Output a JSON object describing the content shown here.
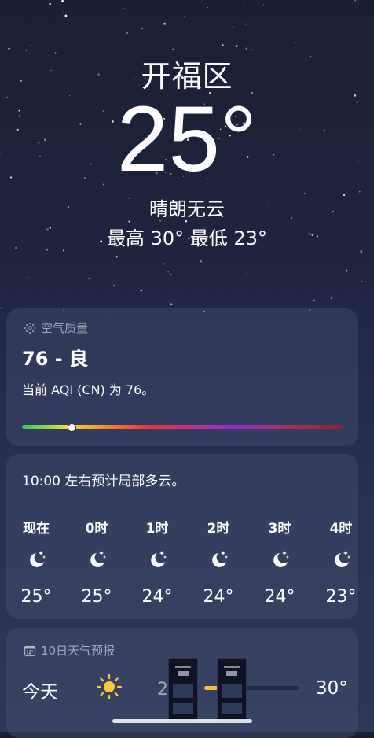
{
  "location": {
    "city": "开福区",
    "temperature": "25°",
    "condition": "晴朗无云",
    "high_low": "最高 30°  最低 23°"
  },
  "aqi": {
    "header": "空气质量",
    "value_label": "76 - 良",
    "description": "当前 AQI (CN) 为 76。",
    "indicator_fraction": 0.155,
    "icon": "aqi-grid-icon"
  },
  "hourly": {
    "summary": "10:00 左右预计局部多云。",
    "items": [
      {
        "label": "现在",
        "icon": "moon-stars-icon",
        "temp": "25°"
      },
      {
        "label": "0时",
        "icon": "moon-stars-icon",
        "temp": "25°"
      },
      {
        "label": "1时",
        "icon": "moon-stars-icon",
        "temp": "24°"
      },
      {
        "label": "2时",
        "icon": "moon-stars-icon",
        "temp": "24°"
      },
      {
        "label": "3时",
        "icon": "moon-stars-icon",
        "temp": "24°"
      },
      {
        "label": "4时",
        "icon": "moon-stars-icon",
        "temp": "23°"
      }
    ]
  },
  "ten_day": {
    "header": "10日天气预报",
    "icon": "calendar-icon",
    "days": [
      {
        "name": "今天",
        "icon": "sun-icon",
        "low": "2",
        "high": "30°"
      }
    ]
  },
  "colors": {
    "sun": "#f6c93b",
    "bar_warm": "#f09a2c"
  }
}
